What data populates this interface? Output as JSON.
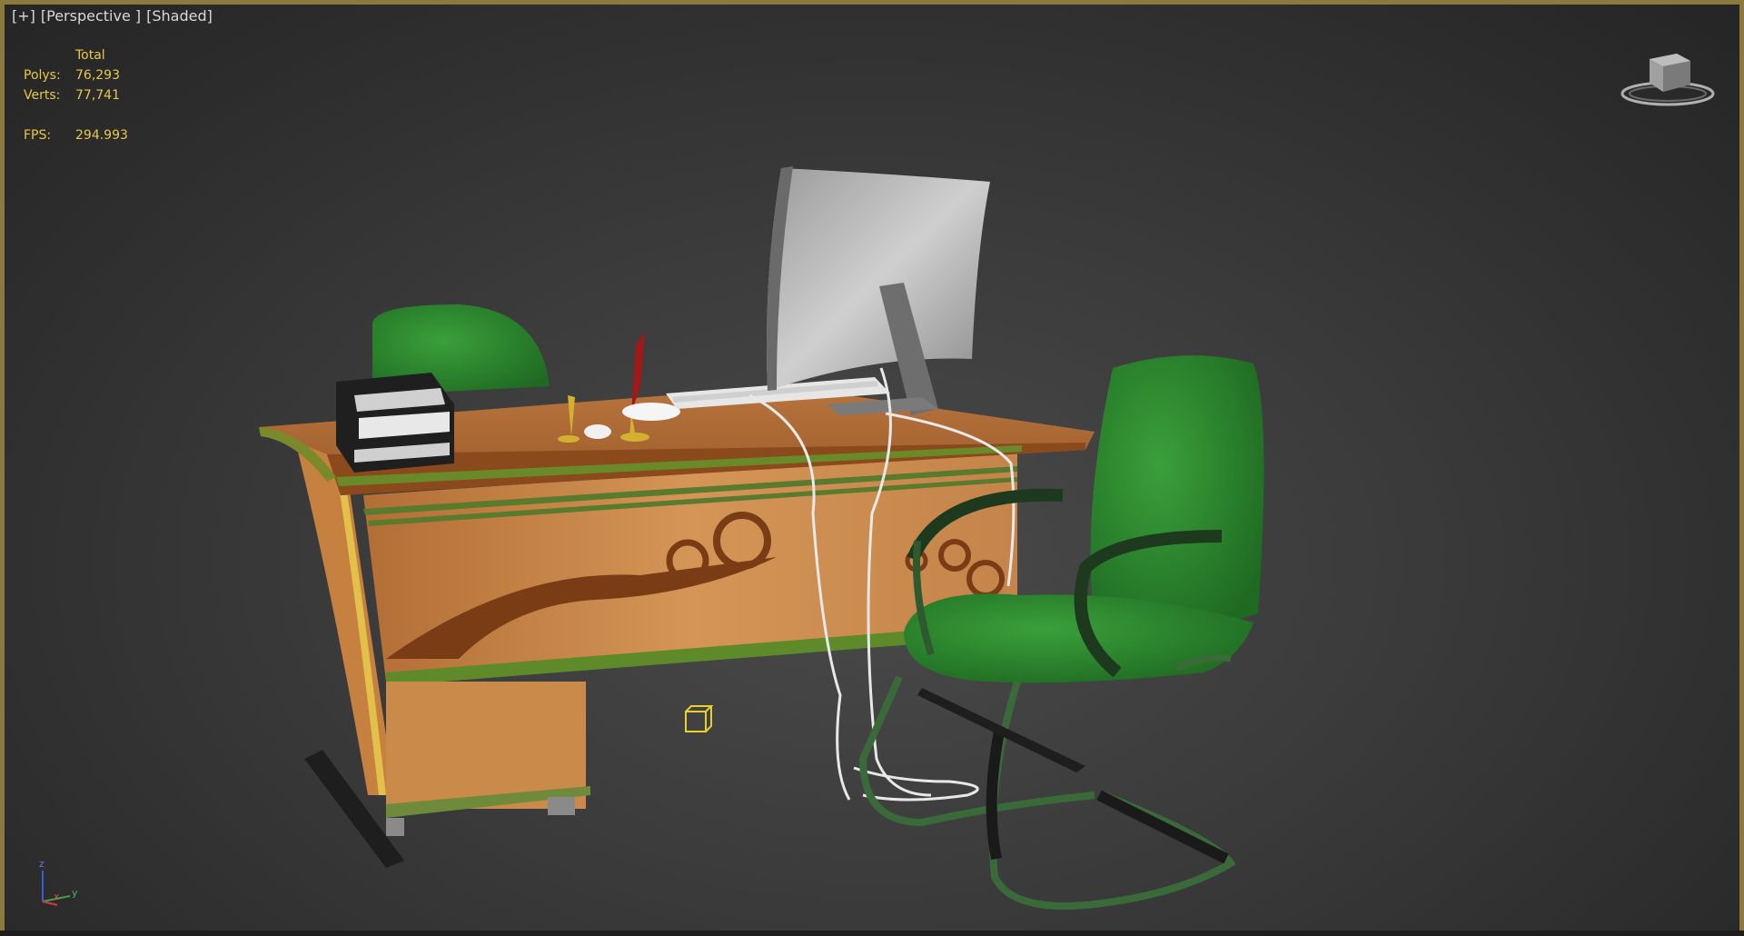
{
  "viewport": {
    "labels": [
      "[+]",
      "[Perspective ]",
      "[Shaded]"
    ]
  },
  "stats": {
    "header": "Total",
    "polys_label": "Polys:",
    "polys_value": "76,293",
    "verts_label": "Verts:",
    "verts_value": "77,741",
    "fps_label": "FPS:",
    "fps_value": "294.993"
  },
  "axis": {
    "z": "z",
    "x": "x",
    "y": "y"
  },
  "colors": {
    "stats_text": "#e8c84a",
    "viewport_border": "#8c7a3c",
    "chair_green": "#2f8a2f",
    "wood": "#c98a4a"
  },
  "icons": {
    "viewcube": "viewcube-icon",
    "camera_target": "cube-gizmo-icon",
    "axis": "axis-tripod-icon"
  }
}
